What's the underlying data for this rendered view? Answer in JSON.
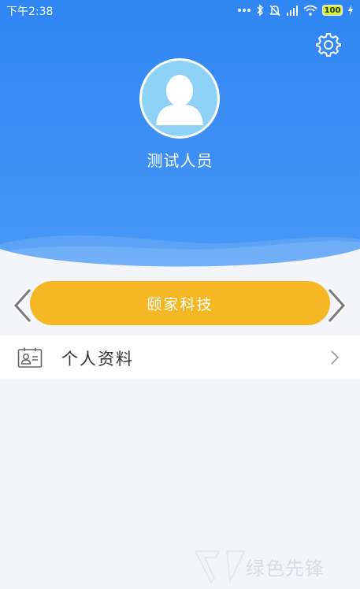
{
  "status_bar": {
    "time": "下午2:38",
    "battery": "100",
    "icons": [
      "dots-icon",
      "bluetooth-icon",
      "silent-icon",
      "signal-icon",
      "wifi-icon",
      "battery-icon",
      "charging-icon"
    ]
  },
  "profile": {
    "name": "测试人员",
    "avatar_icon": "user-silhouette-icon"
  },
  "company": {
    "name": "颐家科技"
  },
  "menu": {
    "items": [
      {
        "label": "个人资料",
        "icon": "id-card-icon"
      }
    ]
  },
  "watermark": {
    "text": "绿色先锋"
  },
  "colors": {
    "header_blue": "#3d8ff5",
    "pill_yellow": "#f5b824",
    "background": "#f3f5fa"
  }
}
